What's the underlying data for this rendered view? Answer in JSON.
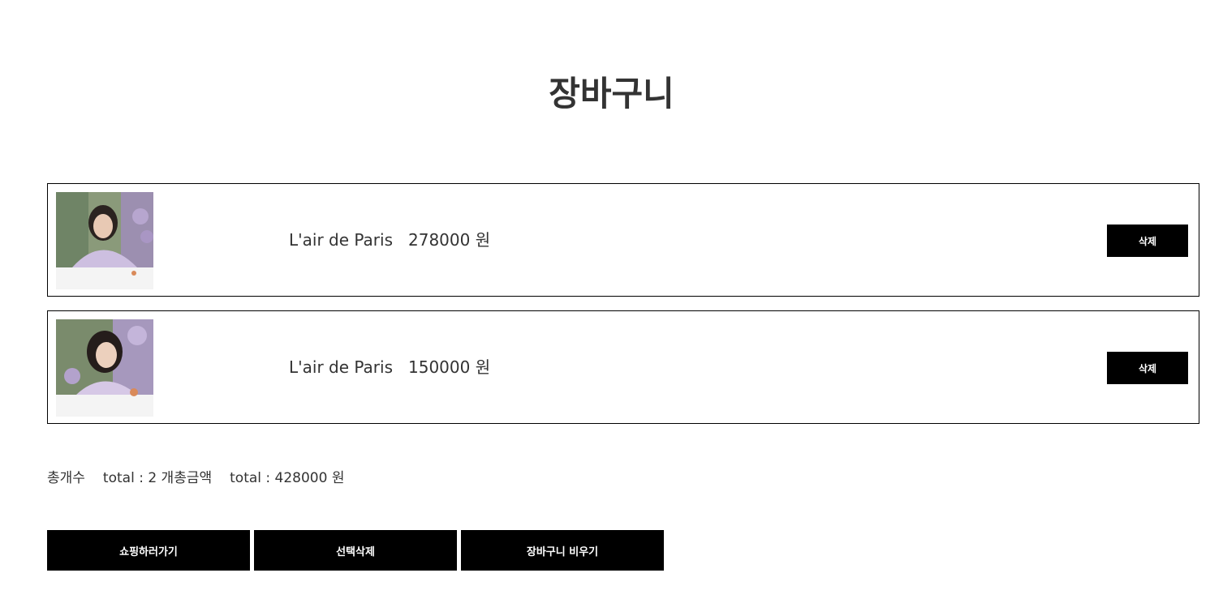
{
  "page": {
    "title": "장바구니"
  },
  "cart": {
    "items": [
      {
        "name": "L'air de Paris",
        "price": "278000 원",
        "delete_label": "삭제",
        "image": "product-photo-woman-lilac"
      },
      {
        "name": "L'air de Paris",
        "price": "150000 원",
        "delete_label": "삭제",
        "image": "product-photo-woman-flowers"
      }
    ]
  },
  "summary": {
    "count_label": "총개수",
    "count_value": "total : 2 개",
    "amount_label": "총금액",
    "amount_value": "total : 428000 원"
  },
  "actions": {
    "shopping_label": "쇼핑하러가기",
    "delete_selected_label": "선택삭제",
    "empty_cart_label": "장바구니 비우기"
  },
  "colors": {
    "text": "#333333",
    "button_bg": "#000000",
    "button_text": "#ffffff",
    "border": "#000000"
  }
}
